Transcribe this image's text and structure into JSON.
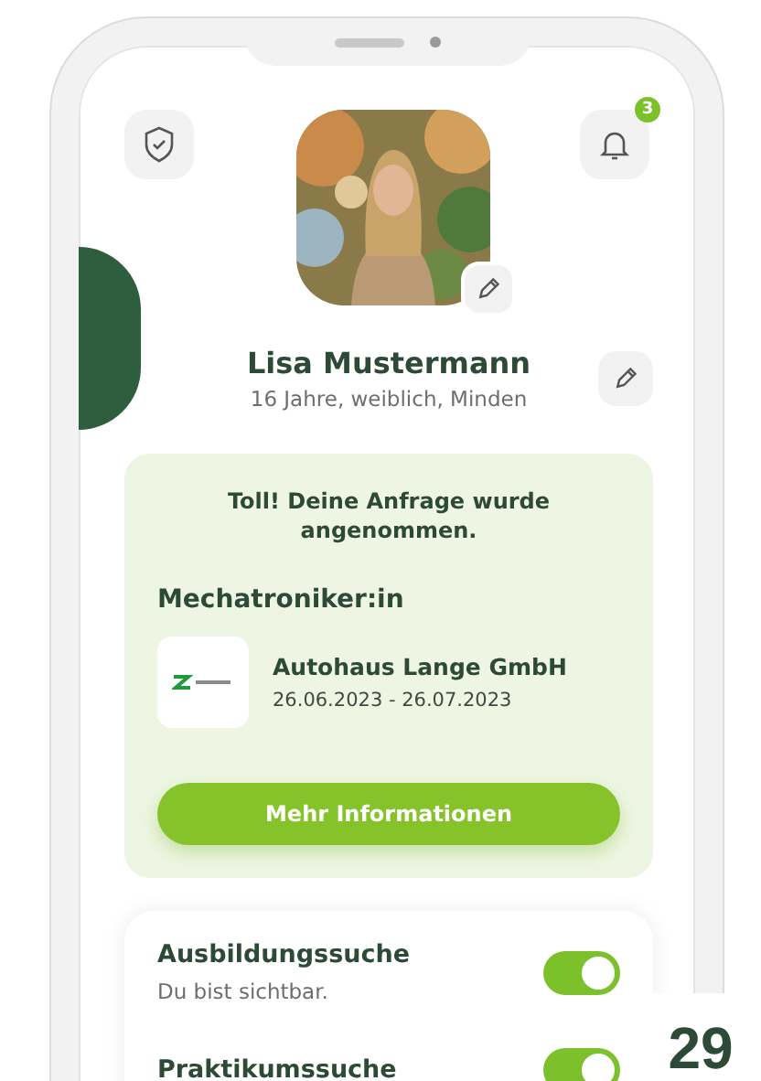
{
  "header": {
    "notification_count": "3"
  },
  "profile": {
    "name": "Lisa Mustermann",
    "details": "16 Jahre, weiblich, Minden"
  },
  "request_card": {
    "message": "Toll! Deine Anfrage wurde angenommen.",
    "job_title": "Mechatroniker:in",
    "company": "Autohaus Lange GmbH",
    "period": "26.06.2023 - 26.07.2023",
    "button": "Mehr Informationen"
  },
  "visibility": [
    {
      "label": "Ausbildungssuche",
      "status": "Du bist sichtbar.",
      "on": true
    },
    {
      "label": "Praktikumssuche",
      "on": true
    }
  ],
  "page_number": "29"
}
